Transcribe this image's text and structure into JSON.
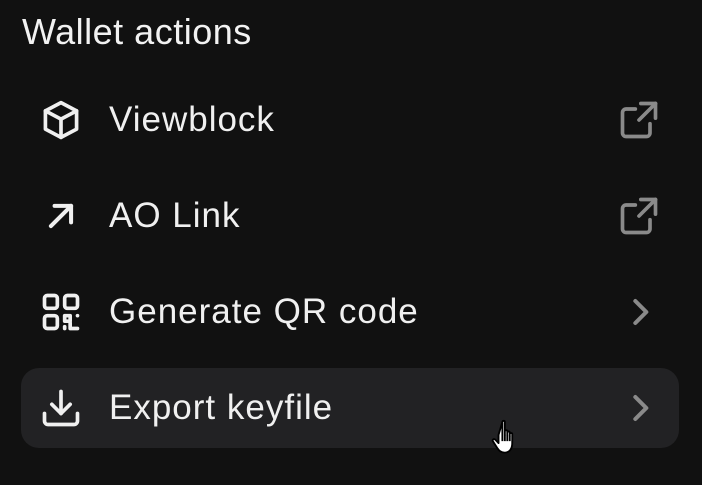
{
  "section": {
    "title": "Wallet actions"
  },
  "actions": [
    {
      "label": "Viewblock",
      "icon": "cube-icon",
      "trailing": "external-link-icon"
    },
    {
      "label": "AO Link",
      "icon": "arrow-up-right-icon",
      "trailing": "external-link-icon"
    },
    {
      "label": "Generate QR code",
      "icon": "qr-code-icon",
      "trailing": "chevron-right-icon"
    },
    {
      "label": "Export keyfile",
      "icon": "download-icon",
      "trailing": "chevron-right-icon"
    }
  ],
  "colors": {
    "background": "#111111",
    "hover_row": "#222224",
    "text": "#f0f0f0",
    "muted_icon": "#8a8a8a"
  },
  "state": {
    "hovered_item": "Export keyfile"
  }
}
